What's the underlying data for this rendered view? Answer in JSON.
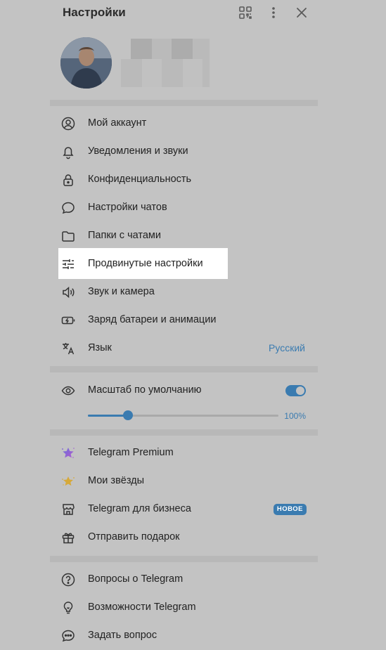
{
  "header": {
    "title": "Настройки",
    "qr_icon": "qr-code-icon",
    "more_icon": "more-vertical-icon",
    "close_icon": "close-icon"
  },
  "menu": [
    {
      "label": "Мой аккаунт",
      "icon": "account-icon"
    },
    {
      "label": "Уведомления и звуки",
      "icon": "bell-icon"
    },
    {
      "label": "Конфиденциальность",
      "icon": "lock-icon"
    },
    {
      "label": "Настройки чатов",
      "icon": "chat-bubble-icon"
    },
    {
      "label": "Папки с чатами",
      "icon": "folder-icon"
    },
    {
      "label": "Продвинутые настройки",
      "icon": "sliders-icon"
    },
    {
      "label": "Звук и камера",
      "icon": "speaker-icon"
    },
    {
      "label": "Заряд батареи и анимации",
      "icon": "battery-icon"
    },
    {
      "label": "Язык",
      "icon": "translate-icon",
      "value": "Русский"
    }
  ],
  "scale": {
    "label": "Масштаб по умолчанию",
    "icon": "eye-icon",
    "toggle_on": true,
    "value_text": "100%",
    "slider_fraction": 0.21
  },
  "premium": [
    {
      "label": "Telegram Premium",
      "icon": "premium-star-icon"
    },
    {
      "label": "Мои звёзды",
      "icon": "stars-icon"
    },
    {
      "label": "Telegram для бизнеса",
      "icon": "store-icon",
      "badge": "НОВОЕ"
    },
    {
      "label": "Отправить подарок",
      "icon": "gift-icon"
    }
  ],
  "help": [
    {
      "label": "Вопросы о Telegram",
      "icon": "question-icon"
    },
    {
      "label": "Возможности Telegram",
      "icon": "lightbulb-icon"
    },
    {
      "label": "Задать вопрос",
      "icon": "chat-dots-icon"
    }
  ],
  "colors": {
    "accent": "#3a7bb0",
    "background": "#c3c3c3",
    "highlight": "#ffffff"
  }
}
